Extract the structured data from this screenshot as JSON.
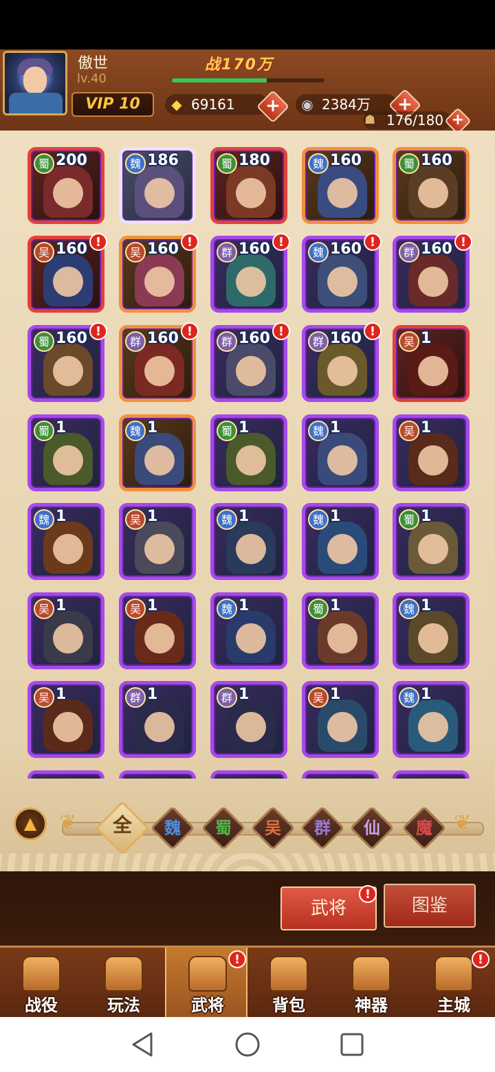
{
  "player": {
    "name": "傲世",
    "level": "lv.40",
    "power": "战170万",
    "exp_progress": 0.62,
    "vip": "VIP 10",
    "gold": "69161",
    "silver": "2384万",
    "stamina": "176/180",
    "plus_symbol": "+"
  },
  "heroes": [
    {
      "faction": "蜀",
      "level": "200",
      "frame": "red",
      "alert": false,
      "tint": "#7a2a2a"
    },
    {
      "faction": "魏",
      "level": "186",
      "frame": "white",
      "alert": false,
      "tint": "#5b4f7e"
    },
    {
      "faction": "蜀",
      "level": "180",
      "frame": "red",
      "alert": false,
      "tint": "#7b3a26"
    },
    {
      "faction": "魏",
      "level": "160",
      "frame": "orange",
      "alert": false,
      "tint": "#3a4b82"
    },
    {
      "faction": "蜀",
      "level": "160",
      "frame": "orange",
      "alert": false,
      "tint": "#5a3d24"
    },
    {
      "faction": "吴",
      "level": "160",
      "frame": "red",
      "alert": true,
      "tint": "#2c3d74"
    },
    {
      "faction": "吴",
      "level": "160",
      "frame": "orange",
      "alert": true,
      "tint": "#8a3a54"
    },
    {
      "faction": "群",
      "level": "160",
      "frame": "purple",
      "alert": true,
      "tint": "#2f6a6a"
    },
    {
      "faction": "魏",
      "level": "160",
      "frame": "purple",
      "alert": true,
      "tint": "#3d4f78"
    },
    {
      "faction": "群",
      "level": "160",
      "frame": "purple",
      "alert": true,
      "tint": "#6a2a2a"
    },
    {
      "faction": "蜀",
      "level": "160",
      "frame": "purple",
      "alert": true,
      "tint": "#6a4a2a"
    },
    {
      "faction": "群",
      "level": "160",
      "frame": "orange",
      "alert": true,
      "tint": "#7a2a22"
    },
    {
      "faction": "群",
      "level": "160",
      "frame": "purple",
      "alert": true,
      "tint": "#4a4a6a"
    },
    {
      "faction": "群",
      "level": "160",
      "frame": "purple",
      "alert": true,
      "tint": "#6a5a2a"
    },
    {
      "faction": "吴",
      "level": "1",
      "frame": "red",
      "alert": false,
      "tint": "#5a1a16"
    },
    {
      "faction": "蜀",
      "level": "1",
      "frame": "purple",
      "alert": false,
      "tint": "#4a5a2a"
    },
    {
      "faction": "魏",
      "level": "1",
      "frame": "orange",
      "alert": false,
      "tint": "#3a4a7a"
    },
    {
      "faction": "蜀",
      "level": "1",
      "frame": "purple",
      "alert": false,
      "tint": "#4a5a2a"
    },
    {
      "faction": "魏",
      "level": "1",
      "frame": "purple",
      "alert": false,
      "tint": "#3a4a7a"
    },
    {
      "faction": "吴",
      "level": "1",
      "frame": "purple",
      "alert": false,
      "tint": "#5a2a1a"
    },
    {
      "faction": "魏",
      "level": "1",
      "frame": "purple",
      "alert": false,
      "tint": "#6a3a1a"
    },
    {
      "faction": "吴",
      "level": "1",
      "frame": "purple",
      "alert": false,
      "tint": "#4a4a5a"
    },
    {
      "faction": "魏",
      "level": "1",
      "frame": "purple",
      "alert": false,
      "tint": "#2a3a5a"
    },
    {
      "faction": "魏",
      "level": "1",
      "frame": "purple",
      "alert": false,
      "tint": "#2a4a7a"
    },
    {
      "faction": "蜀",
      "level": "1",
      "frame": "purple",
      "alert": false,
      "tint": "#6a5a3a"
    },
    {
      "faction": "吴",
      "level": "1",
      "frame": "purple",
      "alert": false,
      "tint": "#3a3a4a"
    },
    {
      "faction": "吴",
      "level": "1",
      "frame": "purple",
      "alert": false,
      "tint": "#6a2a1a"
    },
    {
      "faction": "魏",
      "level": "1",
      "frame": "purple",
      "alert": false,
      "tint": "#2a3a6a"
    },
    {
      "faction": "蜀",
      "level": "1",
      "frame": "purple",
      "alert": false,
      "tint": "#6a3a2a"
    },
    {
      "faction": "魏",
      "level": "1",
      "frame": "purple",
      "alert": false,
      "tint": "#5a4a2a"
    },
    {
      "faction": "吴",
      "level": "1",
      "frame": "purple",
      "alert": false,
      "tint": "#5a2a1a"
    },
    {
      "faction": "群",
      "level": "1",
      "frame": "purple",
      "alert": false,
      "tint": "#2a2a4a"
    },
    {
      "faction": "群",
      "level": "1",
      "frame": "purple",
      "alert": false,
      "tint": "#2a2a4a"
    },
    {
      "faction": "吴",
      "level": "1",
      "frame": "purple",
      "alert": false,
      "tint": "#2a4a6a"
    },
    {
      "faction": "魏",
      "level": "1",
      "frame": "purple",
      "alert": false,
      "tint": "#2a5a7a"
    },
    {
      "faction": "",
      "level": "",
      "frame": "purple",
      "alert": false,
      "tint": "#3a2a4a"
    },
    {
      "faction": "",
      "level": "",
      "frame": "purple",
      "alert": false,
      "tint": "#3a2a4a"
    },
    {
      "faction": "",
      "level": "",
      "frame": "purple",
      "alert": false,
      "tint": "#3a2a4a"
    },
    {
      "faction": "",
      "level": "",
      "frame": "purple",
      "alert": false,
      "tint": "#3a2a4a"
    },
    {
      "faction": "",
      "level": "",
      "frame": "purple",
      "alert": false,
      "tint": "#3a2a4a"
    }
  ],
  "filters": [
    {
      "label": "全",
      "active": true,
      "color": "#6a3c12"
    },
    {
      "label": "魏",
      "active": false,
      "color": "#4a8ee0"
    },
    {
      "label": "蜀",
      "active": false,
      "color": "#4fb54a"
    },
    {
      "label": "吴",
      "active": false,
      "color": "#e0703a"
    },
    {
      "label": "群",
      "active": false,
      "color": "#9a7ad8"
    },
    {
      "label": "仙",
      "active": false,
      "color": "#c8a2e8"
    },
    {
      "label": "魔",
      "active": false,
      "color": "#d84a4a"
    }
  ],
  "tabs": {
    "heroes": "武将",
    "codex": "图鉴",
    "heroes_alert": "!"
  },
  "nav": [
    {
      "label": "战役",
      "icon": "crossed-swords-icon",
      "alert": false
    },
    {
      "label": "玩法",
      "icon": "gate-icon",
      "alert": false
    },
    {
      "label": "武将",
      "icon": "helmet-icon",
      "alert": true
    },
    {
      "label": "背包",
      "icon": "backpack-icon",
      "alert": false
    },
    {
      "label": "神器",
      "icon": "dragon-icon",
      "alert": false
    },
    {
      "label": "主城",
      "icon": "castle-icon",
      "alert": true
    }
  ],
  "alert_symbol": "!",
  "icons": {
    "gold": "gold-ingot-icon",
    "silver": "silver-coin-icon",
    "stamina": "stamina-bowl-icon"
  },
  "icon_glyphs": {
    "gold": "◆",
    "silver": "◉",
    "stamina": "☗",
    "collapse": "▲"
  }
}
